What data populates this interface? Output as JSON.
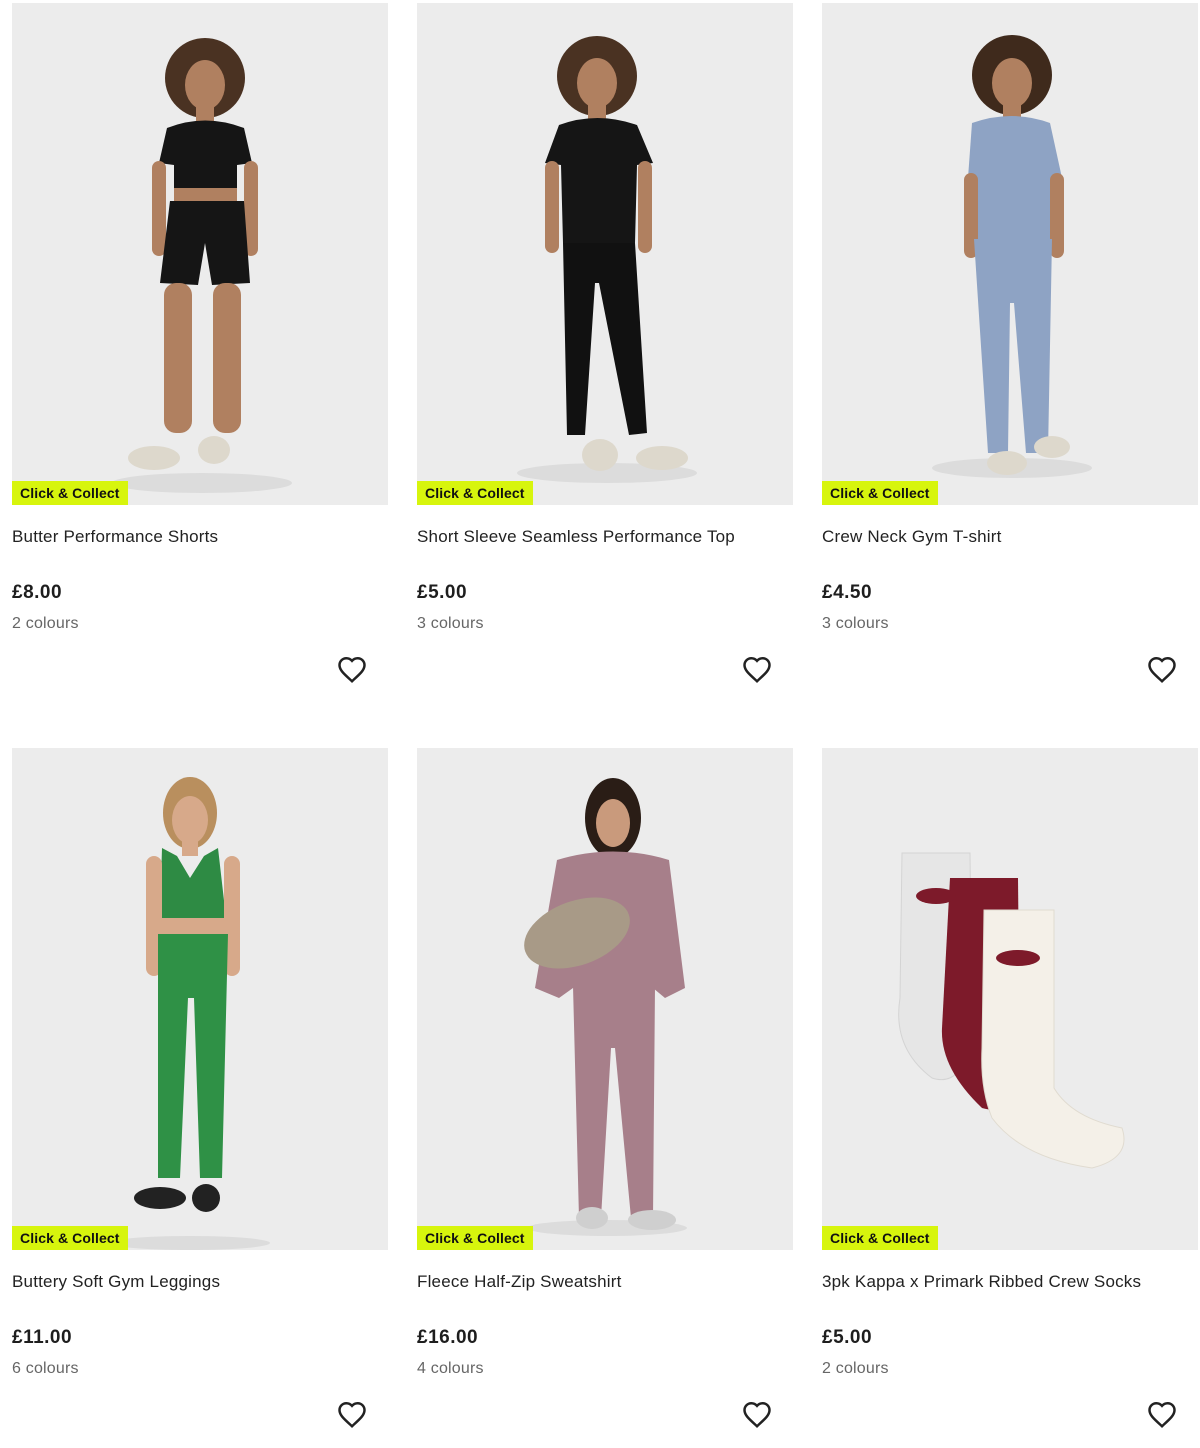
{
  "badge_label": "Click & Collect",
  "products": [
    {
      "title": "Butter Performance Shorts",
      "price": "£8.00",
      "colours": "2 colours"
    },
    {
      "title": "Short Sleeve Seamless Performance Top",
      "price": "£5.00",
      "colours": "3 colours"
    },
    {
      "title": "Crew Neck Gym T-shirt",
      "price": "£4.50",
      "colours": "3 colours"
    },
    {
      "title": "Buttery Soft Gym Leggings",
      "price": "£11.00",
      "colours": "6 colours"
    },
    {
      "title": "Fleece Half-Zip Sweatshirt",
      "price": "£16.00",
      "colours": "4 colours"
    },
    {
      "title": "3pk Kappa x Primark Ribbed Crew Socks",
      "price": "£5.00",
      "colours": "2 colours"
    }
  ],
  "colors": {
    "badge": "#d7f50d",
    "image_bg": "#ececec"
  },
  "icons": {
    "favourite": "heart-outline-icon"
  }
}
